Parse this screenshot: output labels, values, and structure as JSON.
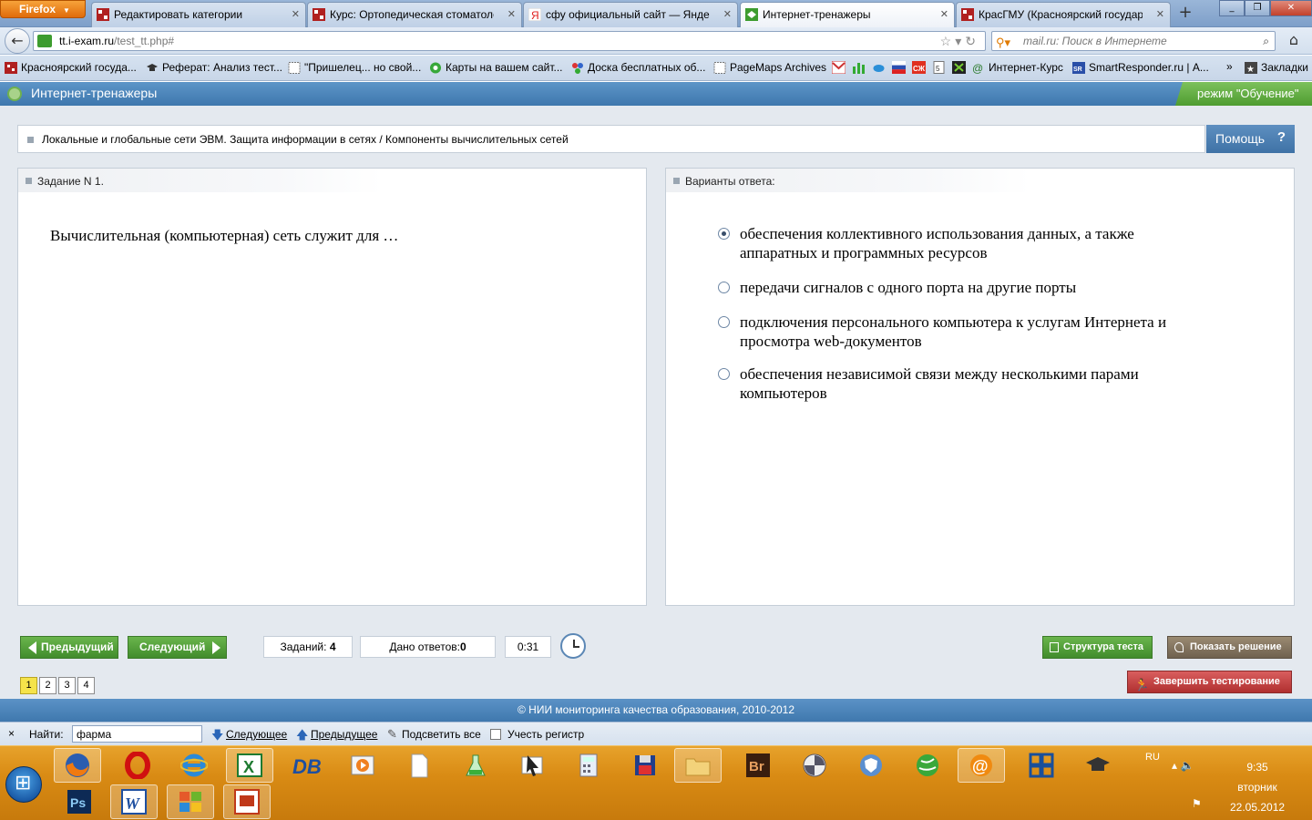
{
  "browser": {
    "menu_label": "Firefox",
    "tabs": [
      {
        "title": "Редактировать категории",
        "active": false
      },
      {
        "title": "Курс: Ортопедическая стоматоло...",
        "active": false
      },
      {
        "title": "сфу официальный сайт — Яндек...",
        "active": false
      },
      {
        "title": "Интернет-тренажеры",
        "active": true
      },
      {
        "title": "КрасГМУ (Красноярский государ...",
        "active": false
      }
    ],
    "url_host": "tt.i-exam.ru",
    "url_path": "/test_tt.php#",
    "search_placeholder": "mail.ru: Поиск в Интернете",
    "bookmarks": [
      "Красноярский госуда...",
      "Реферат: Анализ тест...",
      "\"Пришелец... но свой...",
      "Карты на вашем сайт...",
      "Доска бесплатных об...",
      "PageMaps Archives",
      "Интернет-Курс",
      "SmartResponder.ru | А...",
      "Закладки"
    ]
  },
  "app": {
    "title": "Интернет-тренажеры",
    "mode": "режим \"Обучение\"",
    "breadcrumb": "Локальные и глобальные сети ЭВМ. Защита информации в сетях / Компоненты вычислительных сетей",
    "help_label": "Помощь",
    "help_icon": "?",
    "question_header": "Задание N 1.",
    "question_text": "Вычислительная (компьютерная) сеть служит для …",
    "answers_header": "Варианты ответа:",
    "options": [
      {
        "text": "обеспечения коллективного использования данных, а также аппаратных и программных ресурсов",
        "selected": true
      },
      {
        "text": "передачи сигналов с одного порта на другие порты",
        "selected": false
      },
      {
        "text": "подключения персонального компьютера к услугам Интернета и просмотра web-документов",
        "selected": false
      },
      {
        "text": "обеспечения независимой связи между несколькими парами компьютеров",
        "selected": false
      }
    ],
    "prev_label": "Предыдущий",
    "next_label": "Следующий",
    "tasks_label": "Заданий:",
    "tasks_count": "4",
    "answered_label": "Дано ответов:",
    "answered_count": "0",
    "timer": "0:31",
    "structure_label": "Структура теста",
    "solution_label": "Показать решение",
    "finish_label": "Завершить тестирование",
    "pages": [
      "1",
      "2",
      "3",
      "4"
    ],
    "current_page": "1",
    "footer": "© НИИ мониторинга качества образования, 2010-2012"
  },
  "findbar": {
    "close": "×",
    "label": "Найти:",
    "value": "фарма",
    "next": "Следующее",
    "prev": "Предыдущее",
    "highlight": "Подсветить все",
    "match_case": "Учесть регистр"
  },
  "taskbar": {
    "apps_row1": [
      "firefox",
      "opera",
      "ie",
      "excel",
      "db",
      "player",
      "file",
      "flask",
      "cursor",
      "calc",
      "floppy",
      "folder",
      "Br",
      "pinwheel",
      "shield",
      "globe",
      "mail",
      "grid",
      "gradcap"
    ],
    "apps_row2": [
      "Ps",
      "W",
      "explorer",
      "pp"
    ],
    "lang": "RU",
    "time": "9:35",
    "day": "вторник",
    "date": "22.05.2012"
  },
  "colors": {
    "accent_blue": "#3e77ad",
    "green_button": "#4e9c30",
    "red_button": "#b03030",
    "taskbar_orange": "#d98b14"
  }
}
